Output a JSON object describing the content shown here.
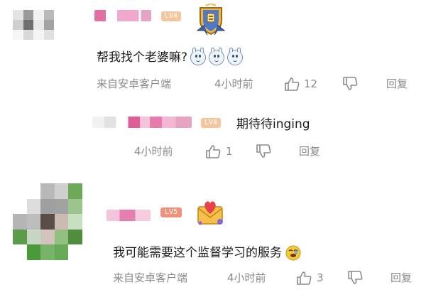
{
  "comments": [
    {
      "level_badge": "LV4",
      "text": "帮我找个老婆嘛?",
      "emoji_icons": [
        "smile-face-icon",
        "smile-face-icon",
        "smile-face-icon"
      ],
      "source": "来自安卓客户端",
      "time": "4小时前",
      "likes": "12",
      "reply_label": "回复",
      "replies": [
        {
          "level_badge": "LV4",
          "text": "期待待inging",
          "time": "4小时前",
          "likes": "1",
          "reply_label": "回复"
        }
      ]
    },
    {
      "level_badge": "LV5",
      "text": "我可能需要这个监督学习的服务",
      "emoji_icon": "smirk-emoji-icon",
      "source": "来自安卓客户端",
      "time": "4小时前",
      "likes": "3",
      "reply_label": "回复"
    }
  ],
  "colors": {
    "meta_gray": "#8a8a8a",
    "name_pink": "#e7a6c6",
    "level_orange": "#f1a363",
    "level_red": "#e9604f"
  }
}
